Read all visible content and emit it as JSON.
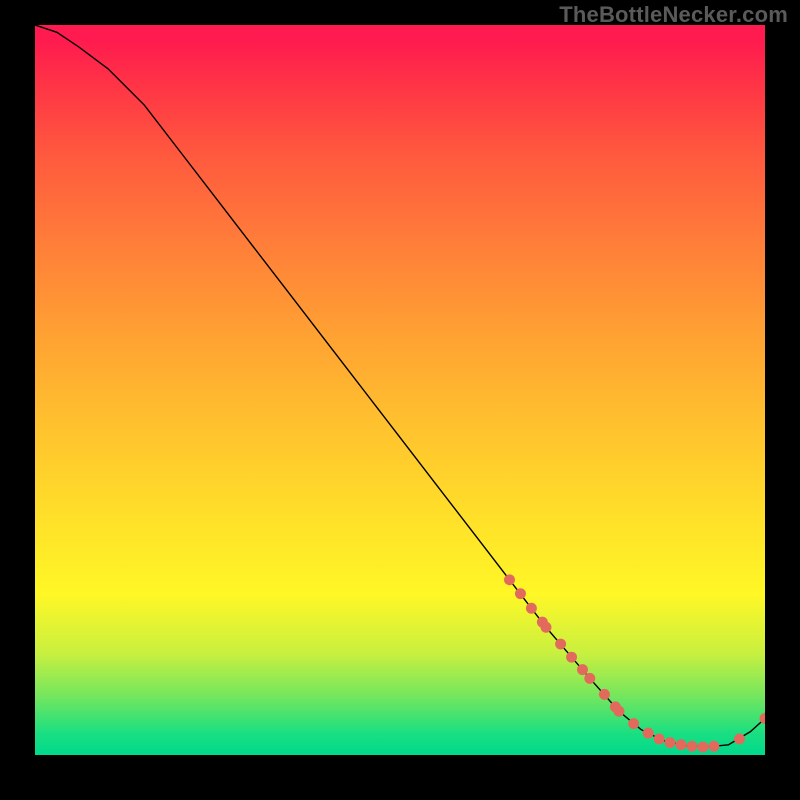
{
  "watermark": "TheBottleNecker.com",
  "colors": {
    "line": "#000000",
    "marker": "#e26a5d",
    "gradient_top": "#ff1a4f",
    "gradient_bottom": "#00d98c"
  },
  "chart_data": {
    "type": "line",
    "title": "",
    "xlabel": "",
    "ylabel": "",
    "xlim": [
      0,
      100
    ],
    "ylim": [
      0,
      100
    ],
    "series": [
      {
        "name": "bottleneck-curve",
        "x": [
          0,
          3,
          6,
          10,
          15,
          20,
          25,
          30,
          35,
          40,
          45,
          50,
          55,
          60,
          65,
          70,
          73,
          76,
          80,
          83,
          86,
          89,
          92,
          95,
          98,
          100
        ],
        "y": [
          100,
          99,
          97,
          94,
          89,
          82.5,
          76,
          69.5,
          63,
          56.5,
          50,
          43.5,
          37,
          30.5,
          24,
          17.5,
          14,
          10.5,
          6,
          3.5,
          2,
          1.3,
          1.1,
          1.4,
          3.2,
          5
        ]
      }
    ],
    "markers": [
      {
        "x": 65.0,
        "y": 24.0
      },
      {
        "x": 66.5,
        "y": 22.1
      },
      {
        "x": 68.0,
        "y": 20.1
      },
      {
        "x": 69.5,
        "y": 18.2
      },
      {
        "x": 70.0,
        "y": 17.5
      },
      {
        "x": 72.0,
        "y": 15.2
      },
      {
        "x": 73.5,
        "y": 13.4
      },
      {
        "x": 75.0,
        "y": 11.7
      },
      {
        "x": 76.0,
        "y": 10.5
      },
      {
        "x": 78.0,
        "y": 8.3
      },
      {
        "x": 79.5,
        "y": 6.6
      },
      {
        "x": 80.0,
        "y": 6.0
      },
      {
        "x": 82.0,
        "y": 4.3
      },
      {
        "x": 84.0,
        "y": 3.0
      },
      {
        "x": 85.5,
        "y": 2.2
      },
      {
        "x": 87.0,
        "y": 1.7
      },
      {
        "x": 88.5,
        "y": 1.4
      },
      {
        "x": 90.0,
        "y": 1.2
      },
      {
        "x": 91.5,
        "y": 1.1
      },
      {
        "x": 93.0,
        "y": 1.2
      },
      {
        "x": 96.5,
        "y": 2.2
      },
      {
        "x": 100.0,
        "y": 5.0
      }
    ]
  }
}
